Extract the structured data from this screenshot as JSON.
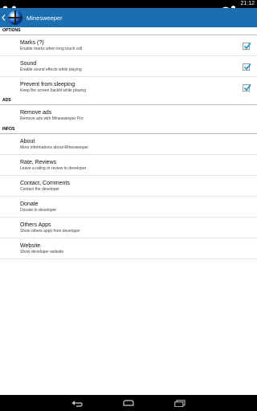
{
  "status_bar": {
    "time": "21:12",
    "left_icons": [
      "notification-icon",
      "android-icon"
    ],
    "right_icons": [
      "wifi-icon",
      "battery-icon"
    ]
  },
  "action_bar": {
    "title": "Minesweeper",
    "color": "#1b6fb0"
  },
  "sections": [
    {
      "header": "OPTIONS",
      "items": [
        {
          "label": "Marks (?)",
          "desc": "Enable marks when long touch cell",
          "checked": true
        },
        {
          "label": "Sound",
          "desc": "Enable sound effects while playing",
          "checked": true
        },
        {
          "label": "Prevent from sleeping",
          "desc": "Keep the screen backlit while playing",
          "checked": true
        }
      ]
    },
    {
      "header": "ADS",
      "items": [
        {
          "label": "Remove ads",
          "desc": "Remove ads with Minesweeper Pro"
        }
      ]
    },
    {
      "header": "INFOS",
      "items": [
        {
          "label": "About",
          "desc": "More informations about Minesweeper"
        },
        {
          "label": "Rate, Reviews",
          "desc": "Leave a rating or review to developer"
        },
        {
          "label": "Contact, Comments",
          "desc": "Contact the developer"
        },
        {
          "label": "Donate",
          "desc": "Donate to developer"
        },
        {
          "label": "Others Apps",
          "desc": "Show others apps from developer"
        },
        {
          "label": "Website",
          "desc": "Show developer website"
        }
      ]
    }
  ],
  "nav_bar": {
    "buttons": [
      "back-icon",
      "home-icon",
      "recent-apps-icon"
    ]
  },
  "colors": {
    "accent": "#1b6fb0",
    "checkmark": "#2a97d0"
  }
}
